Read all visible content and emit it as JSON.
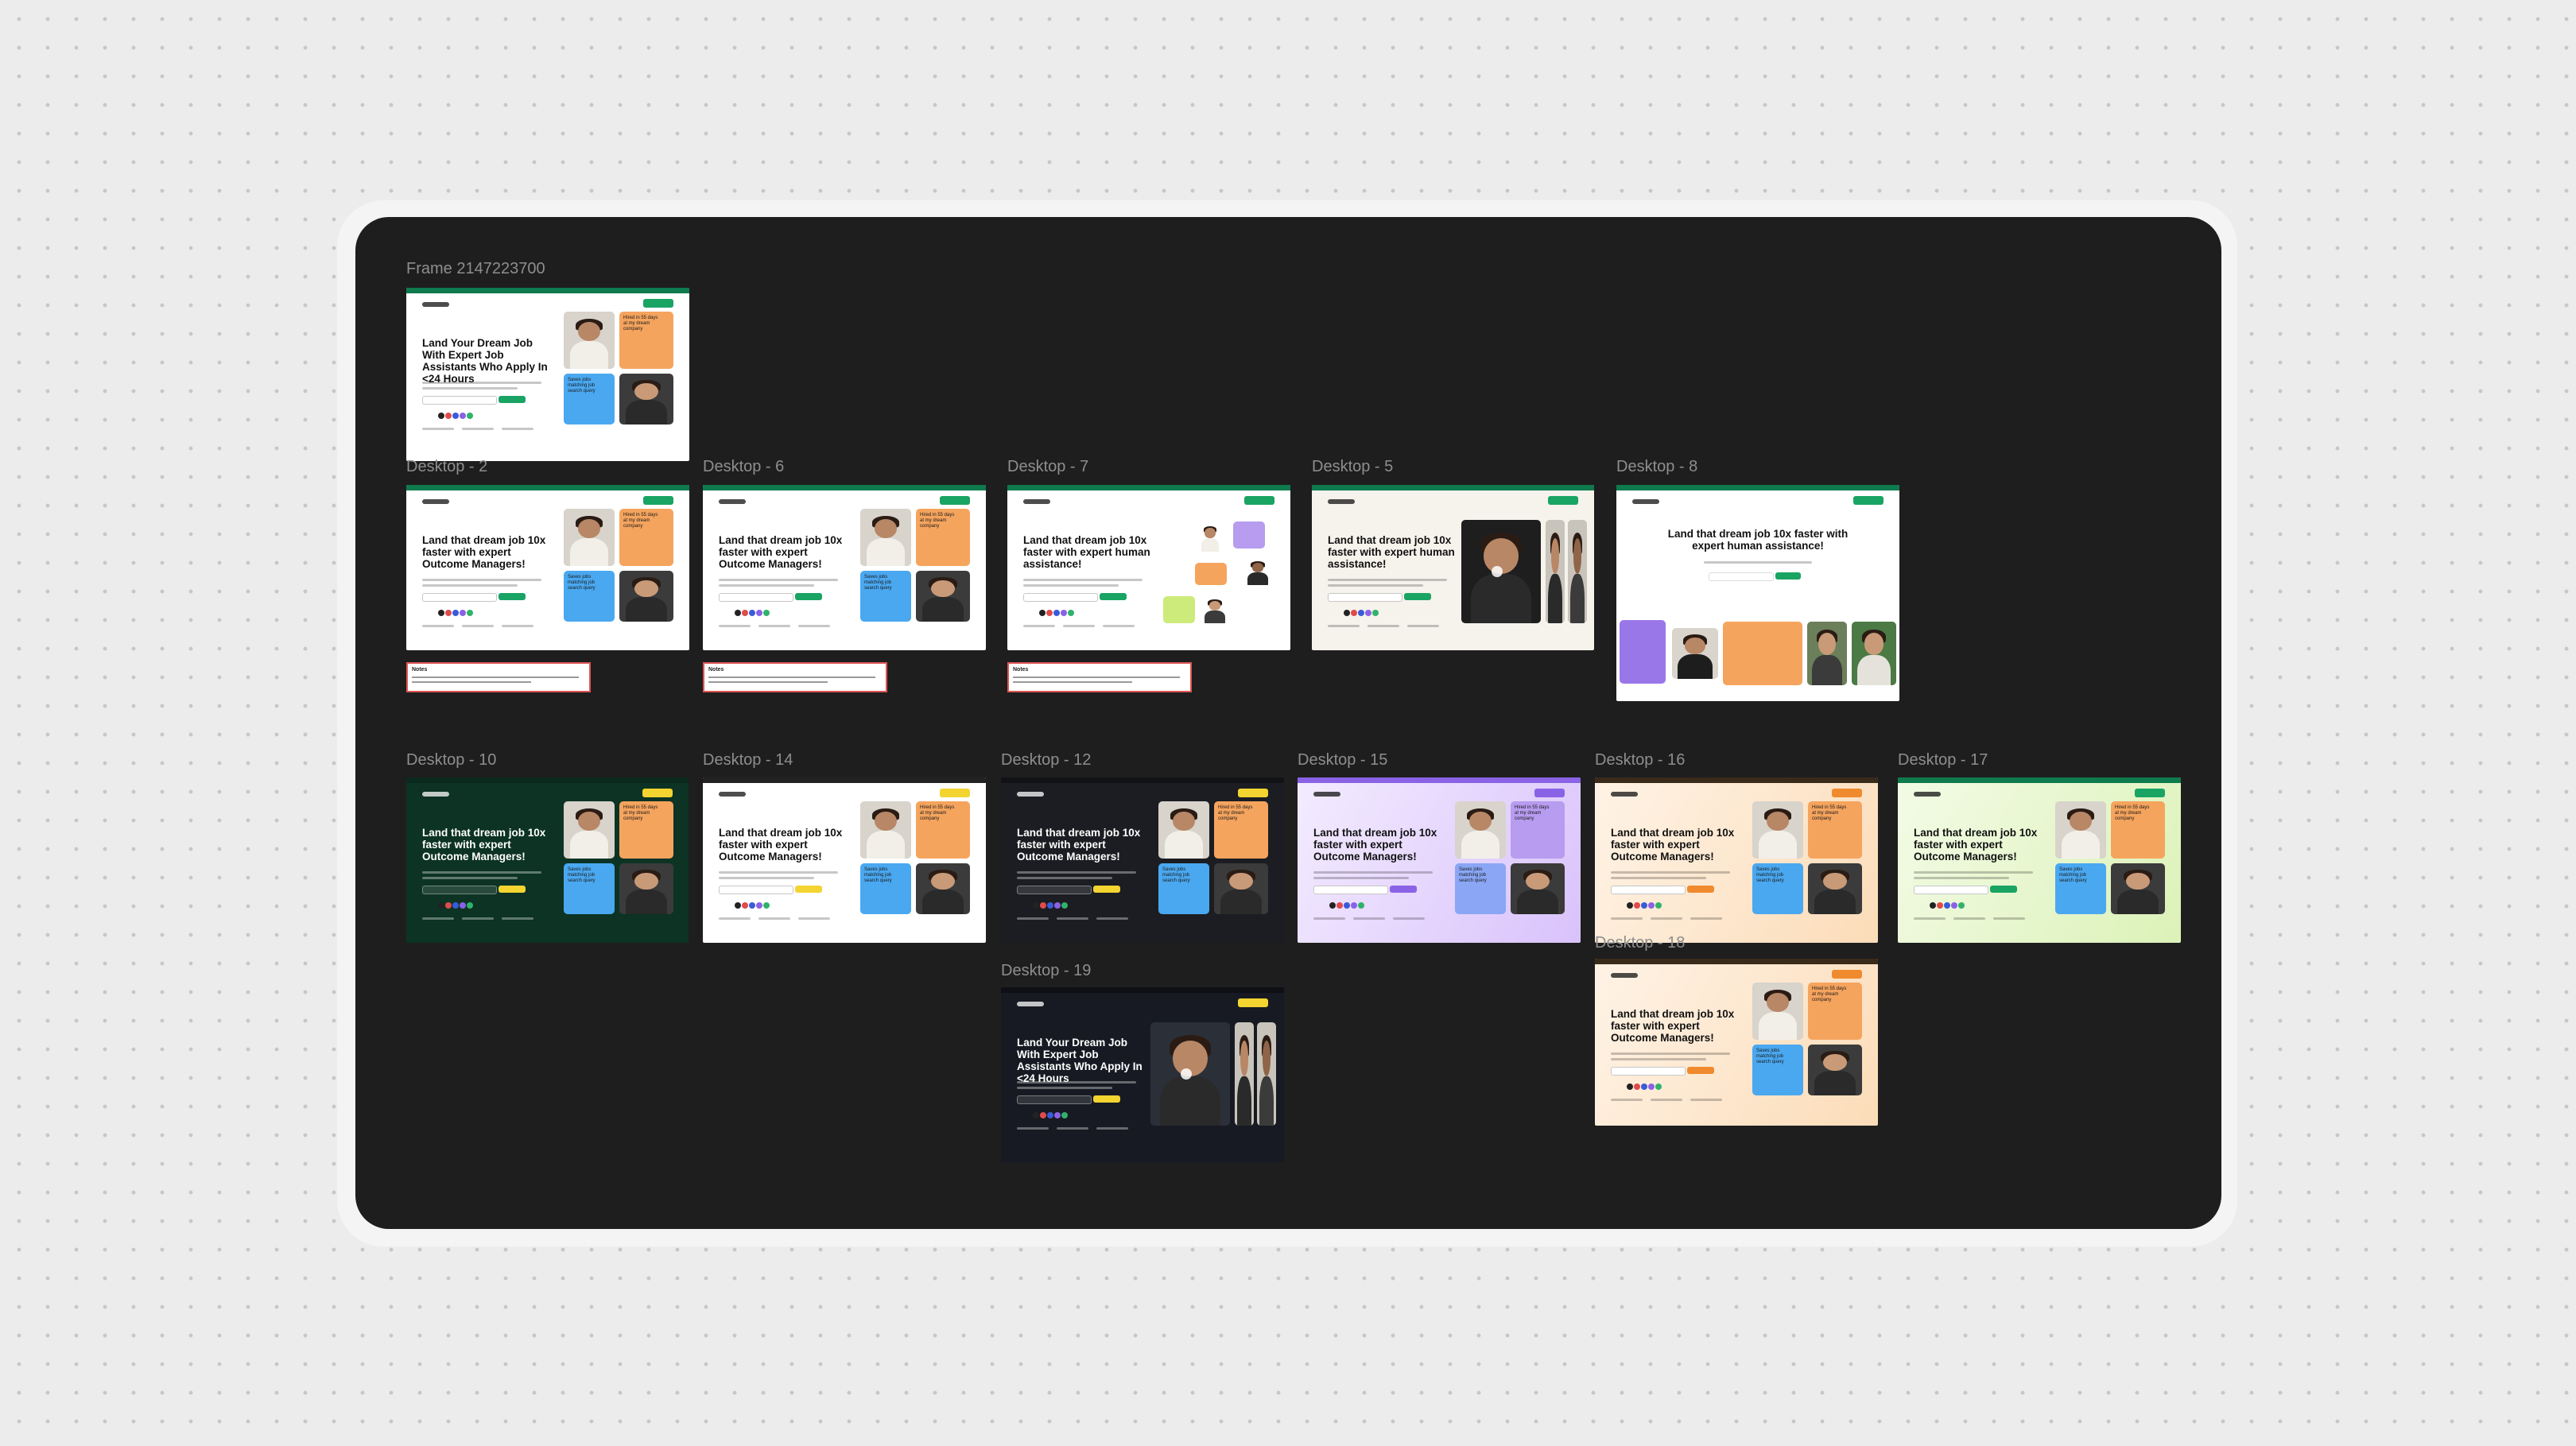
{
  "canvas": {
    "frames": [
      {
        "label": "Frame 2147223700",
        "headline": "Land Your Dream Job With Expert Job Assistants Who Apply In <24 Hours",
        "theme": {
          "bg": "#ffffff",
          "bar": "#0e7a4d",
          "text": "#111111",
          "accent": "#19a463"
        },
        "card1": "Hired in 55 days at my dream company",
        "card2": "Saves jobs matching job search query",
        "layout": "cards"
      },
      {
        "label": "Desktop - 2",
        "headline": "Land that dream job 10x faster with expert Outcome Managers!",
        "theme": {
          "bg": "#ffffff",
          "bar": "#0e7a4d",
          "text": "#111111",
          "accent": "#19a463"
        },
        "card1": "Hired in 55 days at my dream company",
        "card2": "Saves jobs matching job search query",
        "layout": "cards",
        "note": "Notes"
      },
      {
        "label": "Desktop - 6",
        "headline": "Land that dream job 10x faster with expert Outcome Managers!",
        "theme": {
          "bg": "#ffffff",
          "bar": "#0e7a4d",
          "text": "#111111",
          "accent": "#19a463"
        },
        "card1": "Hired in 55 days at my dream company",
        "card2": "Saves jobs matching job search query",
        "layout": "cards",
        "note": "Notes"
      },
      {
        "label": "Desktop - 7",
        "headline": "Land that dream job 10x faster with expert human assistance!",
        "theme": {
          "bg": "#ffffff",
          "bar": "#0e7a4d",
          "text": "#111111",
          "accent": "#19a463"
        },
        "card1": "",
        "card2": "",
        "layout": "orbit",
        "note": "Notes"
      },
      {
        "label": "Desktop - 5",
        "headline": "Land that dream job 10x faster with expert human assistance!",
        "theme": {
          "bg": "#f6f2ec",
          "bar": "#0e7a4d",
          "text": "#111111",
          "accent": "#19a463"
        },
        "card1": "",
        "card2": "",
        "layout": "video"
      },
      {
        "label": "Desktop - 8",
        "headline": "Land that dream job 10x faster with expert human assistance!",
        "theme": {
          "bg": "#ffffff",
          "bar": "#0e7a4d",
          "text": "#111111",
          "accent": "#19a463"
        },
        "card1": "",
        "card2": "",
        "layout": "centered"
      },
      {
        "label": "Desktop - 10",
        "headline": "Land that dream job 10x faster with expert Outcome Managers!",
        "theme": {
          "bg": "#0c3324",
          "bar": "#0a2a1e",
          "text": "#ffffff",
          "accent": "#f3d431"
        },
        "card1": "Hired in 55 days at my dream company",
        "card2": "Saves jobs matching job search query",
        "layout": "cards"
      },
      {
        "label": "Desktop - 14",
        "headline": "Land that dream job 10x faster with expert Outcome Managers!",
        "theme": {
          "bg": "#ffffff",
          "bar": "#222222",
          "text": "#111111",
          "accent": "#f3d431"
        },
        "card1": "Hired in 55 days at my dream company",
        "card2": "Saves jobs matching job search query",
        "layout": "cards"
      },
      {
        "label": "Desktop - 12",
        "headline": "Land that dream job 10x faster with expert Outcome Managers!",
        "theme": {
          "bg": "#1b1d22",
          "bar": "#111316",
          "text": "#ffffff",
          "accent": "#f3d431"
        },
        "card1": "Hired in 55 days at my dream company",
        "card2": "Saves jobs matching job search query",
        "layout": "cards"
      },
      {
        "label": "Desktop - 15",
        "headline": "Land that dream job 10x faster with expert Outcome Managers!",
        "theme": {
          "bg": "#e6d4fb",
          "bar": "#8a62e6",
          "text": "#111111",
          "accent": "#8a62e6"
        },
        "card1": "Hired in 55 days at my dream company",
        "card2": "Saves jobs matching job search query",
        "layout": "cards"
      },
      {
        "label": "Desktop - 16",
        "headline": "Land that dream job 10x faster with expert Outcome Managers!",
        "theme": {
          "bg": "#fbe6cf",
          "bar": "#3a2a1a",
          "text": "#111111",
          "accent": "#f08a2e"
        },
        "card1": "Hired in 55 days at my dream company",
        "card2": "Saves jobs matching job search query",
        "layout": "cards"
      },
      {
        "label": "Desktop - 17",
        "headline": "Land that dream job 10x faster with expert Outcome Managers!",
        "theme": {
          "bg": "#e6f5cf",
          "bar": "#0e7a4d",
          "text": "#111111",
          "accent": "#19a463"
        },
        "card1": "Hired in 55 days at my dream company",
        "card2": "Saves jobs matching job search query",
        "layout": "cards"
      },
      {
        "label": "Desktop - 19",
        "headline": "Land Your Dream Job With Expert Job Assistants Who Apply In <24 Hours",
        "theme": {
          "bg": "#171a22",
          "bar": "#0e1016",
          "text": "#ffffff",
          "accent": "#f3d431"
        },
        "card1": "",
        "card2": "",
        "layout": "video"
      },
      {
        "label": "Desktop - 18",
        "headline": "Land that dream job 10x faster with expert Outcome Managers!",
        "theme": {
          "bg": "#fbe6cf",
          "bar": "#3a2a1a",
          "text": "#111111",
          "accent": "#f08a2e"
        },
        "card1": "Hired in 55 days at my dream company",
        "card2": "Saves jobs matching job search query",
        "layout": "cards"
      }
    ]
  }
}
